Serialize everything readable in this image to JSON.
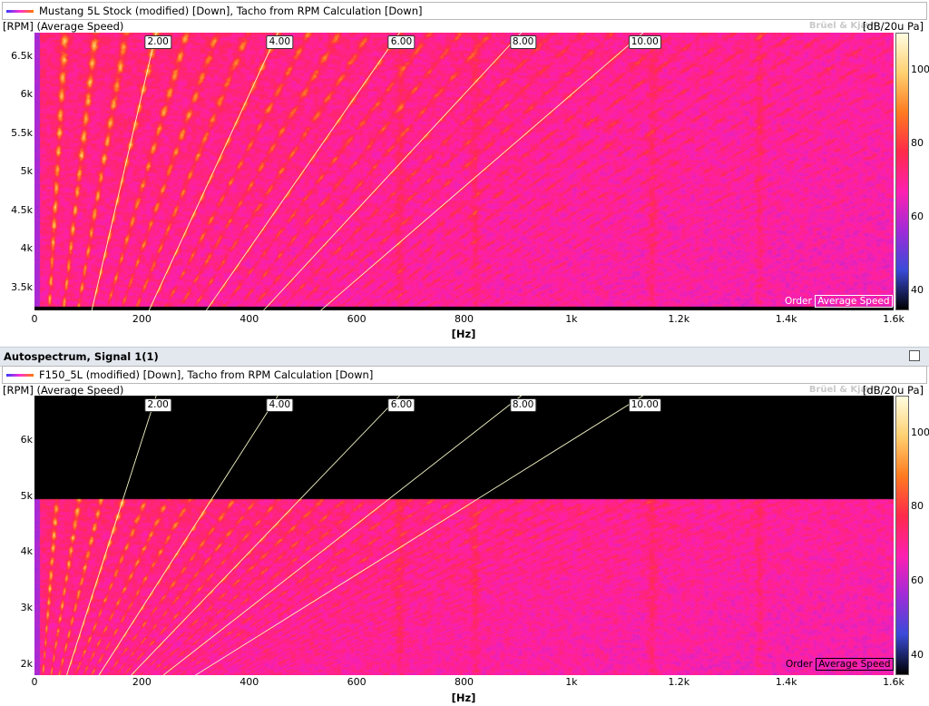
{
  "panels": [
    {
      "legend": "Mustang 5L Stock (modified) [Down], Tacho from RPM Calculation [Down]",
      "ylabel": "[RPM] (Average Speed)",
      "unit": "[dB/20u Pa]",
      "watermark": "Brüel & Kjær",
      "xlabel": "[Hz]",
      "xticks": [
        "0",
        "200",
        "400",
        "600",
        "800",
        "1k",
        "1.2k",
        "1.4k",
        "1.6k"
      ],
      "yticks": [
        "3.5k",
        "4k",
        "4.5k",
        "5k",
        "5.5k",
        "6k",
        "6.5k"
      ],
      "cticks": [
        "40",
        "60",
        "80",
        "100"
      ],
      "order_labels": [
        "2.00",
        "4.00",
        "6.00",
        "8.00",
        "10.00"
      ],
      "footer": "Order",
      "footer_box": "Average Speed"
    },
    {
      "header": "Autospectrum, Signal 1(1)",
      "legend": "F150_5L (modified) [Down], Tacho from RPM Calculation [Down]",
      "ylabel": "[RPM] (Average Speed)",
      "unit": "[dB/20u Pa]",
      "watermark": "Brüel & Kjær",
      "xlabel": "[Hz]",
      "xticks": [
        "0",
        "200",
        "400",
        "600",
        "800",
        "1k",
        "1.2k",
        "1.4k",
        "1.6k"
      ],
      "yticks": [
        "2k",
        "3k",
        "4k",
        "5k",
        "6k"
      ],
      "cticks": [
        "40",
        "60",
        "80",
        "100"
      ],
      "order_labels": [
        "2.00",
        "4.00",
        "6.00",
        "8.00",
        "10.00"
      ],
      "footer": "Order",
      "footer_box": "Average Speed"
    }
  ],
  "chart_data": [
    {
      "type": "heatmap",
      "title": "Mustang 5L Stock (modified) [Down], Tacho from RPM Calculation [Down]",
      "xlabel": "[Hz]",
      "ylabel": "[RPM] (Average Speed)",
      "colorbar_label": "[dB/20u Pa]",
      "xlim": [
        0,
        1600
      ],
      "ylim": [
        3200,
        6800
      ],
      "clim": [
        35,
        110
      ],
      "x_ticks": [
        0,
        200,
        400,
        600,
        800,
        1000,
        1200,
        1400,
        1600
      ],
      "y_ticks": [
        3500,
        4000,
        4500,
        5000,
        5500,
        6000,
        6500
      ],
      "color_ticks": [
        40,
        60,
        80,
        100
      ],
      "order_lines": [
        2,
        4,
        6,
        8,
        10
      ],
      "valid_rpm_range": [
        3250,
        6800
      ]
    },
    {
      "type": "heatmap",
      "title": "F150_5L (modified) [Down], Tacho from RPM Calculation [Down]",
      "xlabel": "[Hz]",
      "ylabel": "[RPM] (Average Speed)",
      "colorbar_label": "[dB/20u Pa]",
      "xlim": [
        0,
        1600
      ],
      "ylim": [
        1800,
        6800
      ],
      "clim": [
        35,
        110
      ],
      "x_ticks": [
        0,
        200,
        400,
        600,
        800,
        1000,
        1200,
        1400,
        1600
      ],
      "y_ticks": [
        2000,
        3000,
        4000,
        5000,
        6000
      ],
      "color_ticks": [
        40,
        60,
        80,
        100
      ],
      "order_lines": [
        2,
        4,
        6,
        8,
        10
      ],
      "valid_rpm_range": [
        1800,
        4950
      ]
    }
  ],
  "colors": {
    "colormap": [
      "#000000",
      "#3a4bd8",
      "#a02bd8",
      "#ff1fb0",
      "#ff2a4a",
      "#ff7a20",
      "#ffd070",
      "#fffde0"
    ],
    "header_bg": "#e3e8ee"
  }
}
